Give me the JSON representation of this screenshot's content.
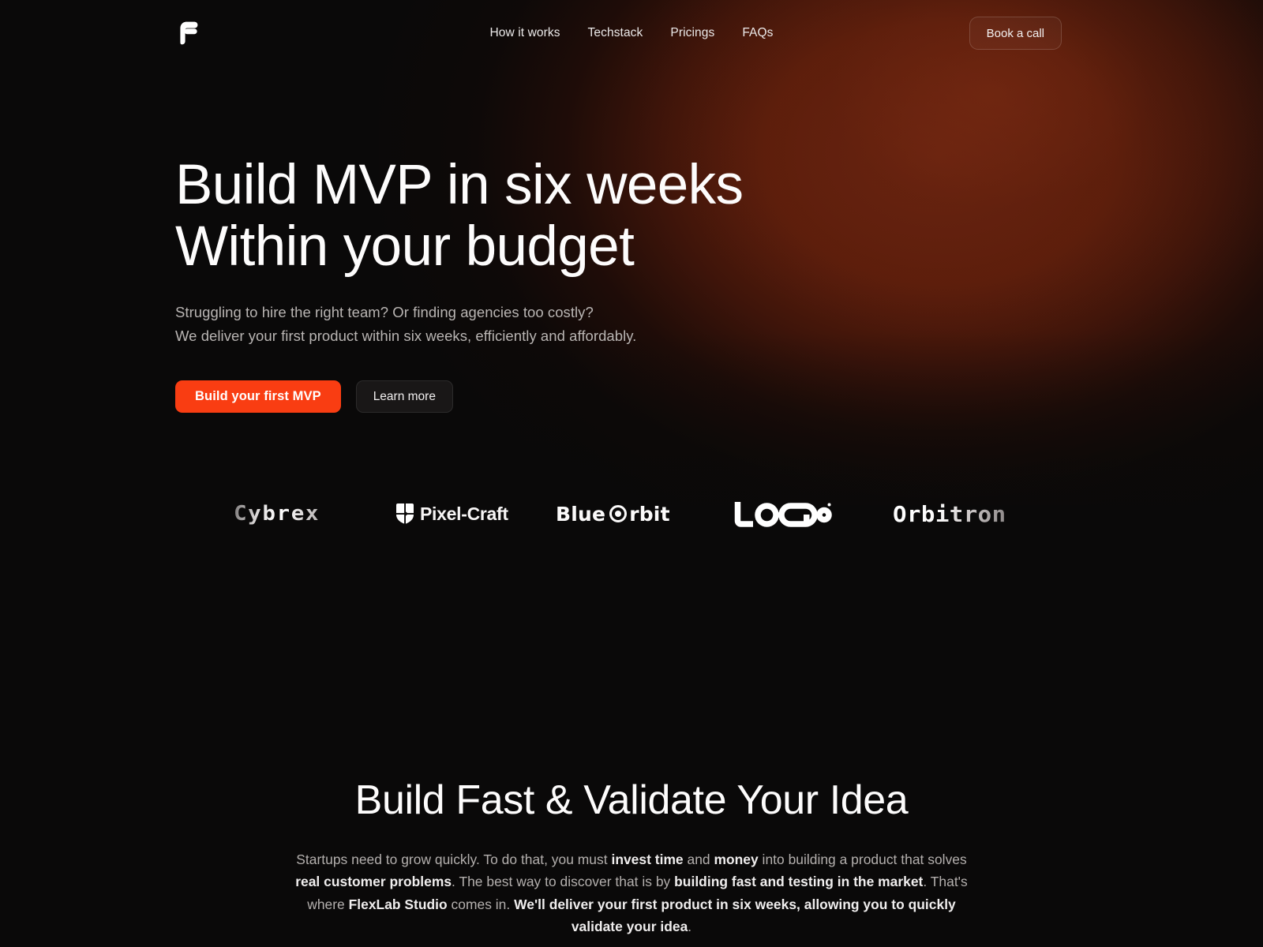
{
  "brand": {
    "logo_icon": "flexlab-f-logo-icon",
    "accent_color": "#f93d12",
    "background_color": "#0a0909",
    "glow_color": "#6b2410"
  },
  "header": {
    "nav_items": [
      {
        "label": "How it works"
      },
      {
        "label": "Techstack"
      },
      {
        "label": "Pricings"
      },
      {
        "label": "FAQs"
      }
    ],
    "cta_label": "Book a call"
  },
  "hero": {
    "title": "Build MVP in six weeks\nWithin your budget",
    "title_line_1": "Build MVP in six weeks",
    "title_line_2": "Within your budget",
    "subtitle": "Struggling to hire the right team? Or finding agencies too costly?\nWe deliver your first product within six weeks, efficiently and affordably.",
    "subtitle_line_1": "Struggling to hire the right team? Or finding agencies too costly?",
    "subtitle_line_2": "We deliver your first product within six weeks, efficiently and affordably.",
    "primary_cta": "Build your first MVP",
    "secondary_cta": "Learn more"
  },
  "logo_strip": {
    "brands": [
      {
        "name": "Cybrex",
        "text": "Cybrex",
        "icon": "none"
      },
      {
        "name": "Pixel-Craft",
        "text": "Pixel-Craft",
        "icon": "shield-icon"
      },
      {
        "name": "Blue Orbit",
        "text_before": "Blue",
        "text_after": "rbit",
        "icon": "orbit-circle-icon"
      },
      {
        "name": "LOGO",
        "text": "LOGO",
        "icon": "none"
      },
      {
        "name": "Orbitron",
        "text": "Orbitron",
        "icon": "none"
      }
    ]
  },
  "section2": {
    "title": "Build Fast & Validate Your Idea",
    "body_segments": [
      {
        "text": "Startups need to grow quickly. To do that, you must ",
        "bold": false
      },
      {
        "text": "invest time",
        "bold": true
      },
      {
        "text": " and ",
        "bold": false
      },
      {
        "text": "money",
        "bold": true
      },
      {
        "text": " into building a product that solves ",
        "bold": false
      },
      {
        "text": "real customer problems",
        "bold": true
      },
      {
        "text": ". The best way to discover that is by ",
        "bold": false
      },
      {
        "text": "building fast and testing in the market",
        "bold": true
      },
      {
        "text": ". That's where ",
        "bold": false
      },
      {
        "text": "FlexLab Studio",
        "bold": true
      },
      {
        "text": " comes in. ",
        "bold": false
      },
      {
        "text": "We'll deliver your first product in six weeks, allowing you to quickly validate your idea",
        "bold": true
      },
      {
        "text": ".",
        "bold": false
      }
    ],
    "body_plain": "Startups need to grow quickly. To do that, you must invest time and money into building a product that solves real customer problems. The best way to discover that is by building fast and testing in the market. That's where FlexLab Studio comes in. We'll deliver your first product in six weeks, allowing you to quickly validate your idea."
  }
}
